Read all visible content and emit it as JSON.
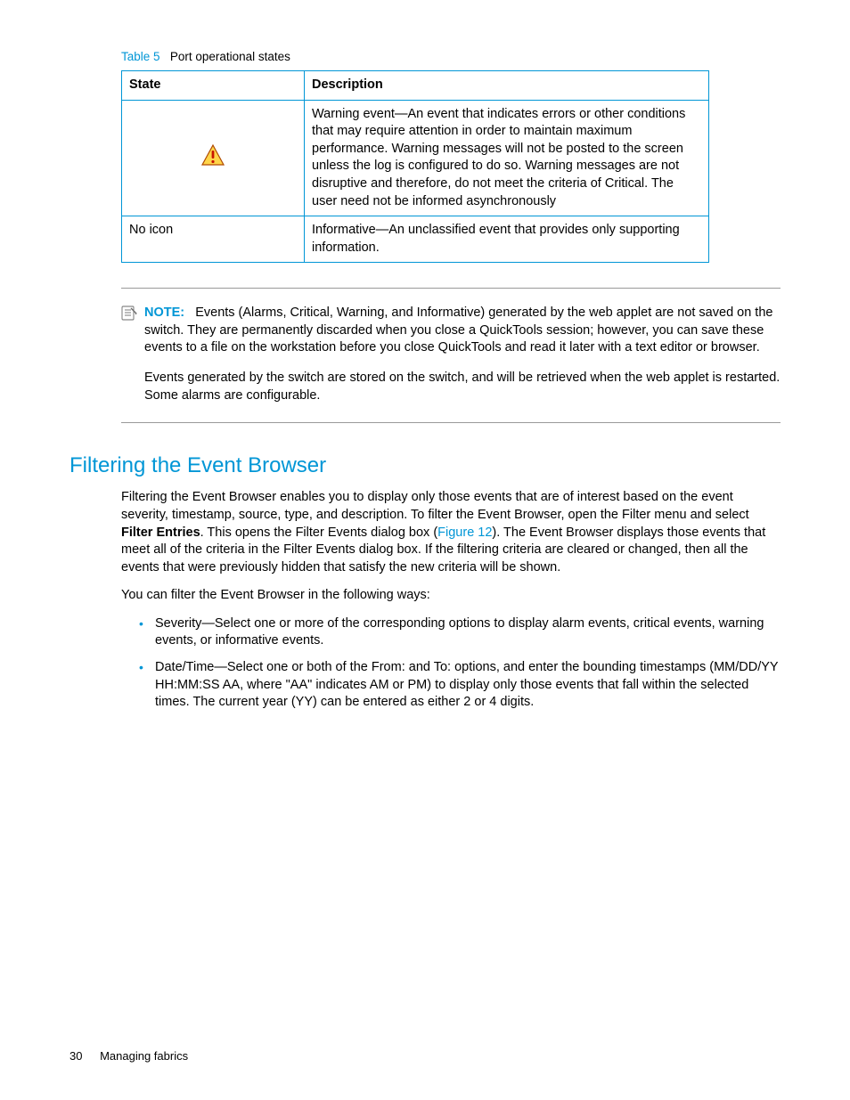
{
  "table": {
    "label": "Table 5",
    "caption": "Port operational states",
    "headers": {
      "state": "State",
      "description": "Description"
    },
    "row1": {
      "description": "Warning event—An event that indicates errors or other conditions that may require attention in order to maintain maximum performance. Warning messages will not be posted to the screen unless the log is configured to do so. Warning messages are not disruptive and therefore, do not meet the criteria of Critical. The user need not be informed asynchronously"
    },
    "row2": {
      "state": "No icon",
      "description": "Informative—An unclassified event that provides only supporting information."
    }
  },
  "note": {
    "label": "NOTE:",
    "p1": "Events (Alarms, Critical, Warning, and Informative) generated by the web applet are not saved on the switch. They are permanently discarded when you close a QuickTools session; however, you can save these events to a file on the workstation before you close QuickTools and read it later with a text editor or browser.",
    "p2": "Events generated by the switch are stored on the switch, and will be retrieved when the web applet is restarted. Some alarms are configurable."
  },
  "section": {
    "heading": "Filtering the Event Browser",
    "p1a": "Filtering the Event Browser enables you to display only those events that are of interest based on the event severity, timestamp, source, type, and description. To filter the Event Browser, open the Filter menu and select ",
    "p1bold": "Filter Entries",
    "p1b": ". This opens the Filter Events dialog box (",
    "p1link": "Figure 12",
    "p1c": "). The Event Browser displays those events that meet all of the criteria in the Filter Events dialog box. If the filtering criteria are cleared or changed, then all the events that were previously hidden that satisfy the new criteria will be shown.",
    "p2": "You can filter the Event Browser in the following ways:",
    "bullets": {
      "b1": "Severity—Select one or more of the corresponding options to display alarm events, critical events, warning events, or informative events.",
      "b2": "Date/Time—Select one or both of the From: and To: options, and enter the bounding timestamps (MM/DD/YY HH:MM:SS AA, where \"AA\" indicates AM or PM) to display only those events that fall within the selected times. The current year (YY) can be entered as either 2 or 4 digits."
    }
  },
  "footer": {
    "page": "30",
    "title": "Managing fabrics"
  }
}
